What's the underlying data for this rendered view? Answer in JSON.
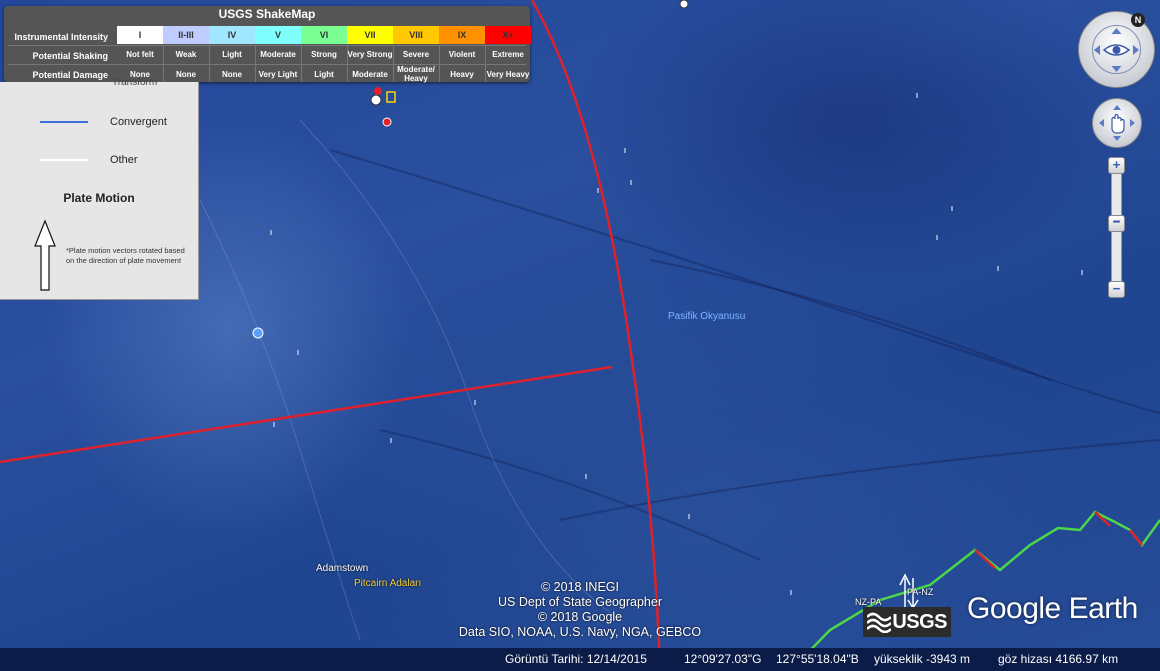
{
  "shakemap": {
    "title": "USGS ShakeMap",
    "row_labels": [
      "Instrumental Intensity",
      "Potential Shaking",
      "Potential Damage"
    ],
    "levels": [
      {
        "intensity": "I",
        "shaking": "Not felt",
        "damage": "None",
        "color": "#ffffff"
      },
      {
        "intensity": "II-III",
        "shaking": "Weak",
        "damage": "None",
        "color": "#bfccff"
      },
      {
        "intensity": "IV",
        "shaking": "Light",
        "damage": "None",
        "color": "#a0e6ff"
      },
      {
        "intensity": "V",
        "shaking": "Moderate",
        "damage": "Very Light",
        "color": "#80ffff"
      },
      {
        "intensity": "VI",
        "shaking": "Strong",
        "damage": "Light",
        "color": "#7aff93"
      },
      {
        "intensity": "VII",
        "shaking": "Very Strong",
        "damage": "Moderate",
        "color": "#ffff00"
      },
      {
        "intensity": "VIII",
        "shaking": "Severe",
        "damage": "Moderate/ Heavy",
        "color": "#ffc800"
      },
      {
        "intensity": "IX",
        "shaking": "Violent",
        "damage": "Heavy",
        "color": "#ff9100"
      },
      {
        "intensity": "X+",
        "shaking": "Extreme",
        "damage": "Very Heavy",
        "color": "#ff0000"
      }
    ]
  },
  "plate_legend": {
    "partial_label": "Transform",
    "items": [
      {
        "label": "Convergent",
        "color": "#3a6fd8"
      },
      {
        "label": "Other",
        "color": "#ffffff"
      }
    ],
    "heading": "Plate Motion",
    "note": "*Plate motion vectors rotated based on the direction of plate movement"
  },
  "map": {
    "ocean_label": "Pasifik Okyanusu",
    "places": [
      {
        "name": "Adamstown",
        "style": "white"
      },
      {
        "name": "Pitcairn Adaları",
        "style": "yellow"
      }
    ],
    "boundary_labels": [
      "NZ-PA",
      "PA-NZ"
    ],
    "boundary_colors": {
      "red": "#e0202a",
      "green": "#4bd64b"
    }
  },
  "credits": [
    "© 2018 INEGI",
    "US Dept of State Geographer",
    "© 2018 Google",
    "Data SIO, NOAA, U.S. Navy, NGA, GEBCO"
  ],
  "logos": {
    "google_earth": "Google Earth",
    "usgs": "USGS"
  },
  "navigation": {
    "north_label": "N",
    "zoom_in": "+",
    "zoom_out": "−",
    "zoom_level": 0.55
  },
  "status": {
    "date_label": "Görüntü Tarihi: 12/14/2015",
    "lat": "12°09'27.03\"G",
    "lon": "127°55'18.04\"B",
    "elevation": "yükseklik -3943 m",
    "eye_alt": "göz hizası 4166.97 km"
  }
}
